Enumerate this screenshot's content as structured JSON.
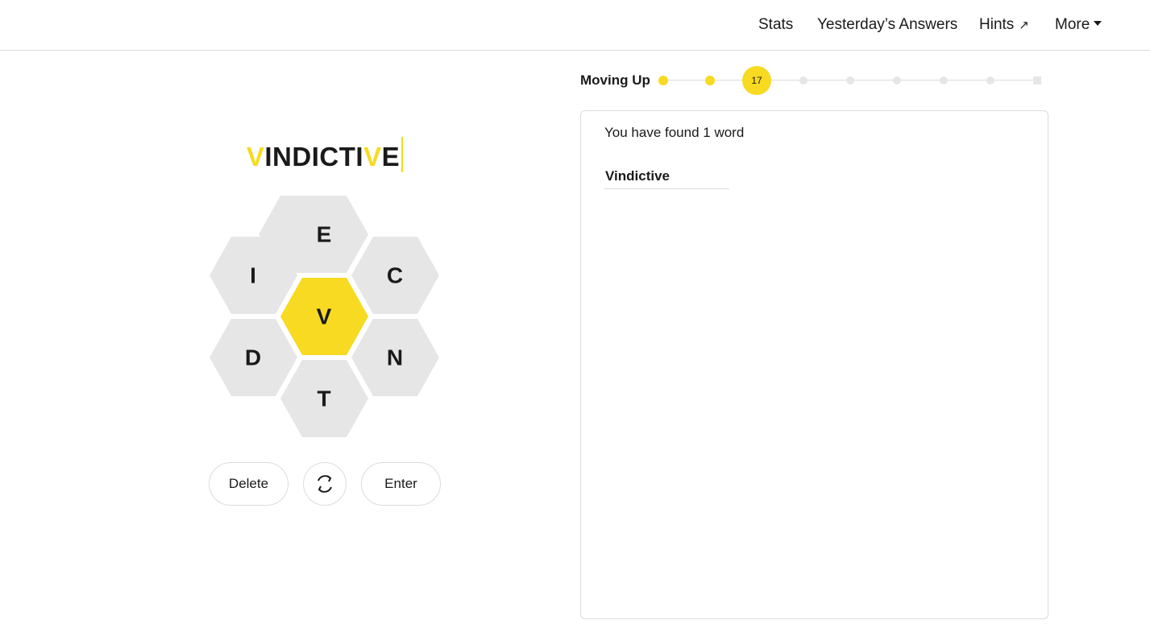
{
  "nav": {
    "stats": "Stats",
    "yesterday": "Yesterday’s Answers",
    "hints": "Hints",
    "hints_arrow": "↗",
    "more": "More"
  },
  "input": {
    "letters": [
      "V",
      "I",
      "N",
      "D",
      "I",
      "C",
      "T",
      "I",
      "V",
      "E"
    ],
    "center_letter": "V"
  },
  "hive": {
    "center": "V",
    "top": "E",
    "upper_left": "I",
    "upper_right": "C",
    "lower_left": "D",
    "lower_right": "N",
    "bottom": "T"
  },
  "controls": {
    "delete": "Delete",
    "enter": "Enter",
    "shuffle_icon": "shuffle-icon"
  },
  "progress": {
    "rank": "Moving Up",
    "score": "17",
    "levels_total": 9,
    "current_level_index": 2
  },
  "wordlist": {
    "summary": "You have found 1 word",
    "words": [
      "Vindictive"
    ]
  },
  "colors": {
    "accent": "#f7da21",
    "tile": "#e6e6e6",
    "border": "#dcdcdc"
  }
}
